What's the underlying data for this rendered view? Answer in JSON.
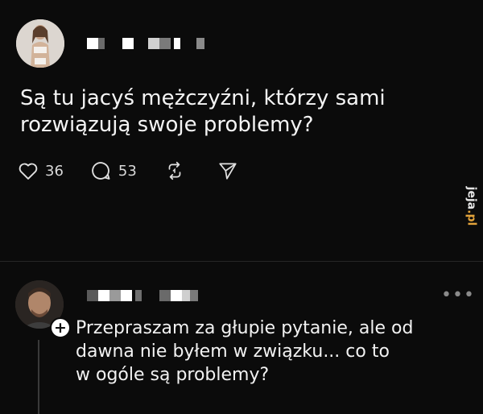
{
  "post": {
    "text_line1": "Są tu jacyś mężczyźni, którzy sami",
    "text_line2": "rozwiązują swoje problemy?",
    "likes": "36",
    "comments": "53"
  },
  "reply": {
    "text_line1": "Przepraszam za głupie pytanie, ale od",
    "text_line2": "dawna nie byłem w związku... co to",
    "text_line3": "w ogóle są problemy?",
    "more_label": "•••",
    "add_label": "+"
  },
  "watermark": {
    "text_main": "jeja",
    "text_accent": ".pl"
  },
  "icons": {
    "like": "heart-icon",
    "comment": "comment-bubble-icon",
    "repost": "repost-icon",
    "share": "send-icon"
  },
  "colors": {
    "background": "#0b0b0b",
    "text": "#f2f2f2",
    "watermark_accent": "#e2a33b"
  }
}
